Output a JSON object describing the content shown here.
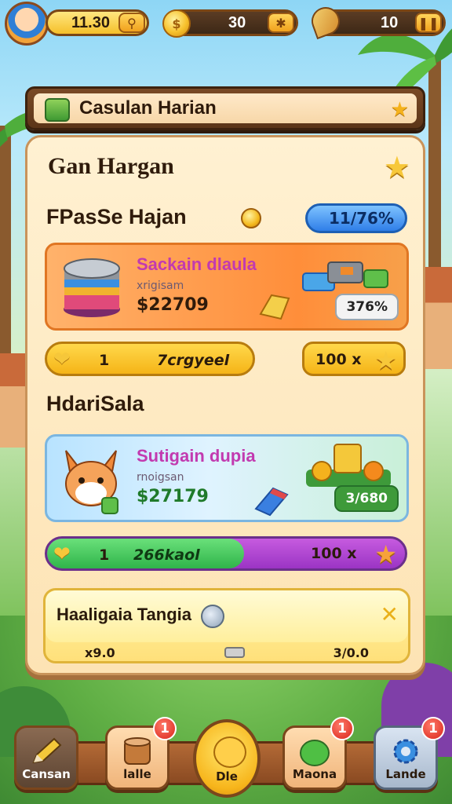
{
  "topbar": {
    "resource1_value": "11.30",
    "resource2_value": "30",
    "resource3_value": "10"
  },
  "banner": {
    "title": "Casulan Harian"
  },
  "panel": {
    "title": "Gan Hargan",
    "section1": {
      "title": "FPasSe Hajan",
      "progress_pill": "11/76%",
      "offer": {
        "name": "Sackain dlaula",
        "subtitle": "xrigisam",
        "price": "$22709",
        "tag": "376%"
      },
      "bar": {
        "count": "1",
        "label": "7crgyeel"
      },
      "reward": {
        "amount": "100 x"
      }
    },
    "section2": {
      "title": "HdariSala",
      "offer": {
        "name": "Sutigain dupia",
        "subtitle": "rnoigsan",
        "price": "$27179",
        "tag": "3/680"
      },
      "bar": {
        "count": "1",
        "label": "266kaol",
        "progress": 0.55
      },
      "reward": {
        "amount": "100 x"
      }
    },
    "bonus": {
      "title": "Haaligaia Tangia",
      "left_value": "x9.0",
      "right_value": "3/0.0"
    }
  },
  "nav": {
    "items": [
      {
        "label": "Cansan",
        "badge": ""
      },
      {
        "label": "lalle",
        "badge": "1"
      },
      {
        "label": "Dle",
        "badge": ""
      },
      {
        "label": "Maona",
        "badge": "1"
      },
      {
        "label": "Lande",
        "badge": "1"
      }
    ]
  },
  "colors": {
    "accent_gold": "#f5b417",
    "wood": "#7a4a26",
    "badge_red": "#d9251a",
    "progress_green": "#2fb44a",
    "progress_purple": "#9b34c4"
  }
}
